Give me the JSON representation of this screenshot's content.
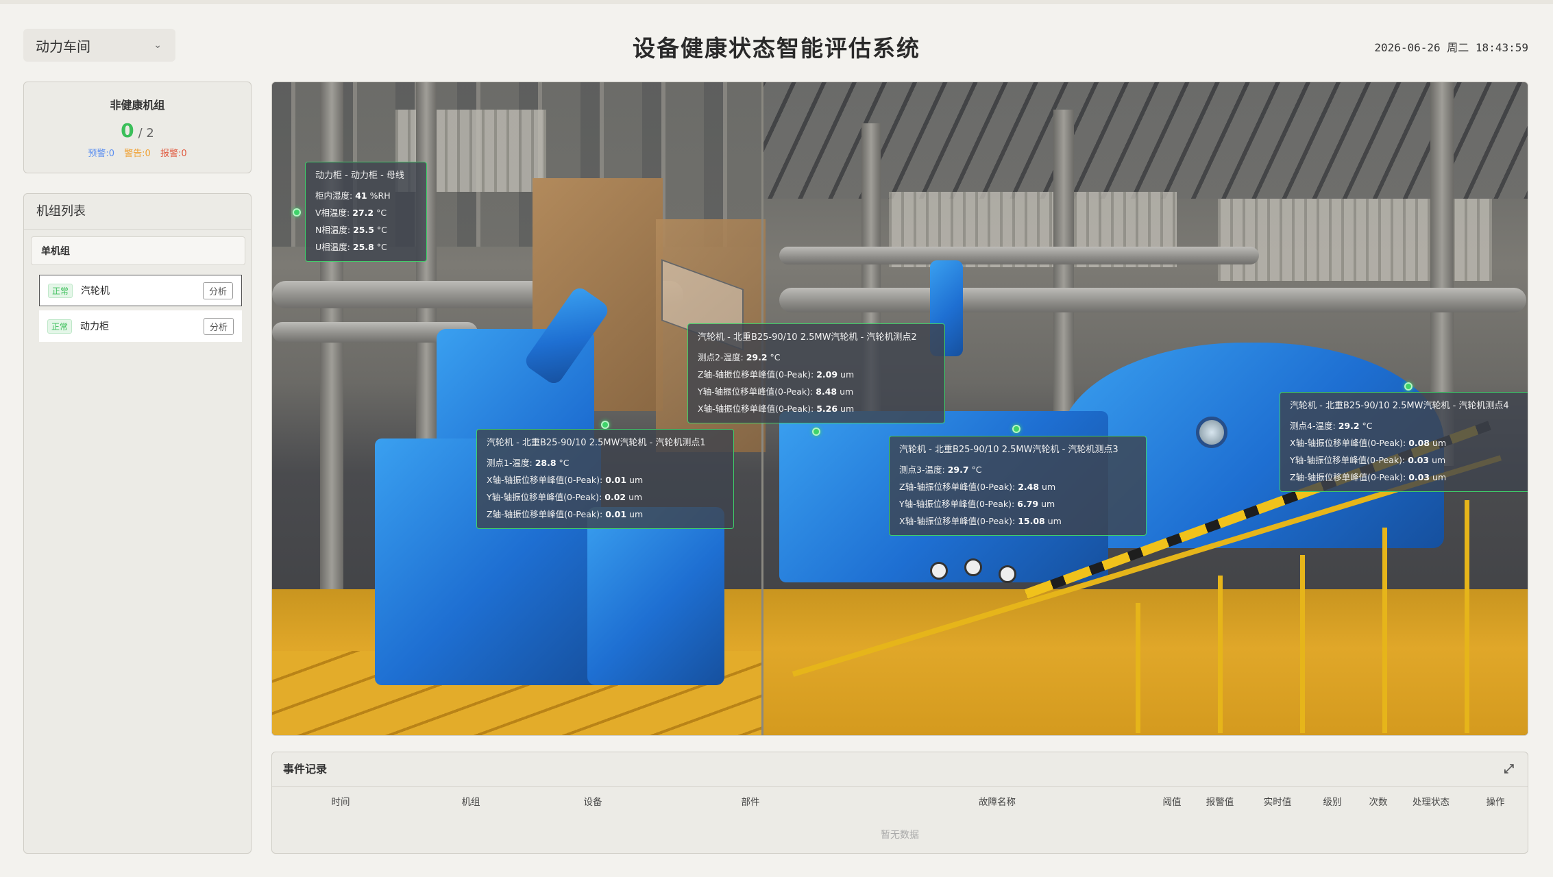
{
  "header": {
    "workshop_select": "动力车间",
    "title": "设备健康状态智能评估系统",
    "datetime": "2026-06-26 周二 18:43:59"
  },
  "unhealthy": {
    "title": "非健康机组",
    "count": "0",
    "total": "/ 2",
    "warning": "预警:0",
    "alert": "警告:0",
    "alarm": "报警:0"
  },
  "unit_list": {
    "title": "机组列表",
    "group": "单机组",
    "items": [
      {
        "status": "正常",
        "name": "汽轮机",
        "action": "分析"
      },
      {
        "status": "正常",
        "name": "动力柜",
        "action": "分析"
      }
    ]
  },
  "tags": [
    {
      "title": "动力柜 - 动力柜 - 母线",
      "rows": [
        {
          "label": "柜内湿度:",
          "value": "41",
          "unit": "%RH"
        },
        {
          "label": "V相温度:",
          "value": "27.2",
          "unit": "°C"
        },
        {
          "label": "N相温度:",
          "value": "25.5",
          "unit": "°C"
        },
        {
          "label": "U相温度:",
          "value": "25.8",
          "unit": "°C"
        }
      ]
    },
    {
      "title": "汽轮机 - 北重B25-90/10 2.5MW汽轮机 - 汽轮机测点1",
      "rows": [
        {
          "label": "测点1-温度:",
          "value": "28.8",
          "unit": "°C"
        },
        {
          "label": "X轴-轴振位移单峰值(0-Peak):",
          "value": "0.01",
          "unit": "um"
        },
        {
          "label": "Y轴-轴振位移单峰值(0-Peak):",
          "value": "0.02",
          "unit": "um"
        },
        {
          "label": "Z轴-轴振位移单峰值(0-Peak):",
          "value": "0.01",
          "unit": "um"
        }
      ]
    },
    {
      "title": "汽轮机 - 北重B25-90/10 2.5MW汽轮机 - 汽轮机测点2",
      "rows": [
        {
          "label": "测点2-温度:",
          "value": "29.2",
          "unit": "°C"
        },
        {
          "label": "Z轴-轴振位移单峰值(0-Peak):",
          "value": "2.09",
          "unit": "um"
        },
        {
          "label": "Y轴-轴振位移单峰值(0-Peak):",
          "value": "8.48",
          "unit": "um"
        },
        {
          "label": "X轴-轴振位移单峰值(0-Peak):",
          "value": "5.26",
          "unit": "um"
        }
      ]
    },
    {
      "title": "汽轮机 - 北重B25-90/10 2.5MW汽轮机 - 汽轮机测点3",
      "rows": [
        {
          "label": "测点3-温度:",
          "value": "29.7",
          "unit": "°C"
        },
        {
          "label": "Z轴-轴振位移单峰值(0-Peak):",
          "value": "2.48",
          "unit": "um"
        },
        {
          "label": "Y轴-轴振位移单峰值(0-Peak):",
          "value": "6.79",
          "unit": "um"
        },
        {
          "label": "X轴-轴振位移单峰值(0-Peak):",
          "value": "15.08",
          "unit": "um"
        }
      ]
    },
    {
      "title": "汽轮机 - 北重B25-90/10 2.5MW汽轮机 - 汽轮机测点4",
      "rows": [
        {
          "label": "测点4-温度:",
          "value": "29.2",
          "unit": "°C"
        },
        {
          "label": "X轴-轴振位移单峰值(0-Peak):",
          "value": "0.08",
          "unit": "um"
        },
        {
          "label": "Y轴-轴振位移单峰值(0-Peak):",
          "value": "0.03",
          "unit": "um"
        },
        {
          "label": "Z轴-轴振位移单峰值(0-Peak):",
          "value": "0.03",
          "unit": "um"
        }
      ]
    }
  ],
  "events": {
    "title": "事件记录",
    "columns": [
      "时间",
      "机组",
      "设备",
      "部件",
      "故障名称",
      "阈值",
      "报警值",
      "实时值",
      "级别",
      "次数",
      "处理状态",
      "操作"
    ],
    "empty_text": "暂无数据"
  },
  "colors": {
    "healthy": "#3bbf5a",
    "warning": "#5b8ff0",
    "alert": "#f0a030",
    "alarm": "#e05a40",
    "tag_border": "#3fcf6a"
  }
}
